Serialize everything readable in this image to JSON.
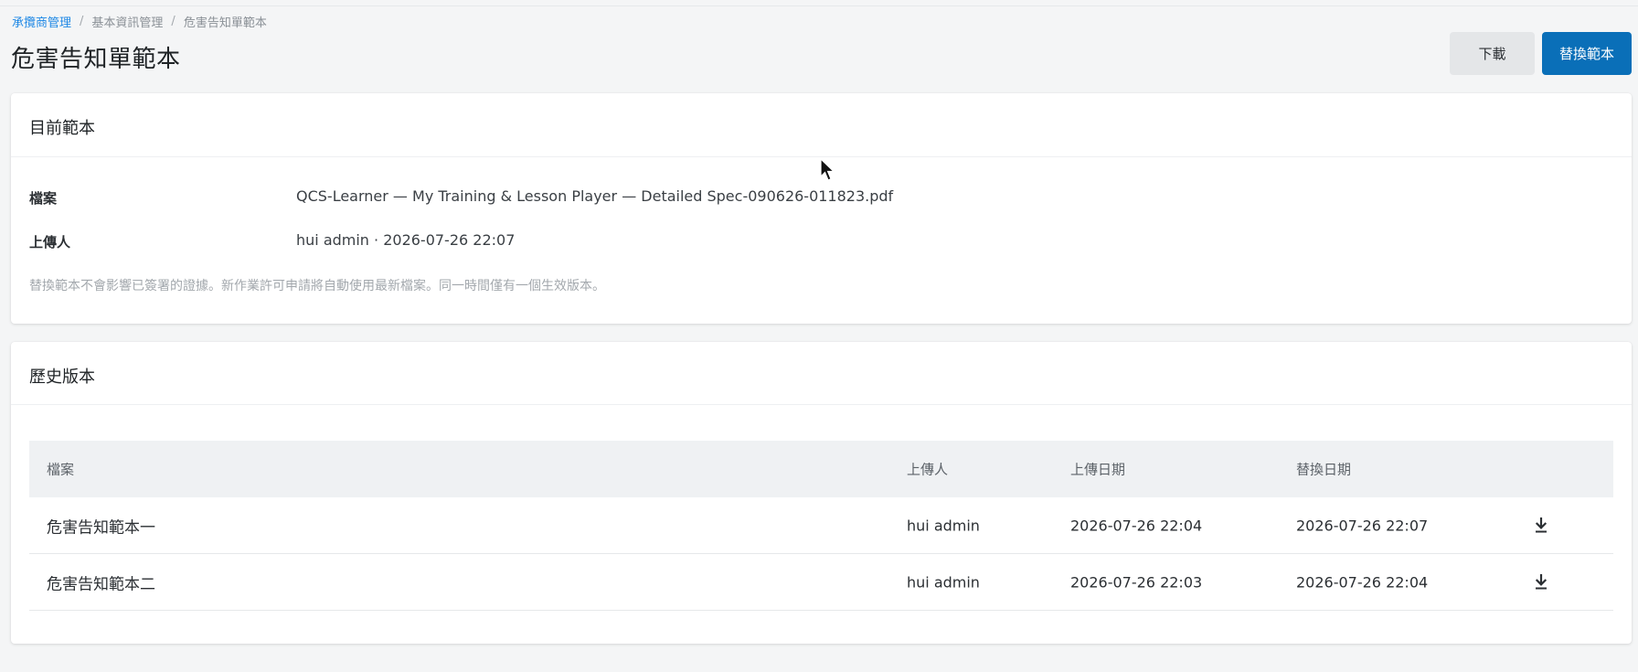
{
  "breadcrumb": {
    "items": [
      "承攬商管理",
      "基本資訊管理",
      "危害告知單範本"
    ],
    "separator": "/"
  },
  "page": {
    "title": "危害告知單範本"
  },
  "toolbar": {
    "download_label": "下載",
    "replace_label": "替換範本"
  },
  "current": {
    "title": "目前範本",
    "file_label": "檔案",
    "file_value": "QCS-Learner — My Training & Lesson Player — Detailed Spec-090626-011823.pdf",
    "uploader_label": "上傳人",
    "uploader_value": "hui admin · 2026-07-26 22:07",
    "note": "替換範本不會影響已簽署的證據。新作業許可申請將自動使用最新檔案。同一時間僅有一個生效版本。"
  },
  "history": {
    "title": "歷史版本",
    "columns": [
      "檔案",
      "上傳人",
      "上傳日期",
      "替換日期"
    ],
    "rows": [
      {
        "file": "危害告知範本一",
        "uploader": "hui admin",
        "upload_date": "2026-07-26 22:04",
        "replace_date": "2026-07-26 22:07"
      },
      {
        "file": "危害告知範本二",
        "uploader": "hui admin",
        "upload_date": "2026-07-26 22:03",
        "replace_date": "2026-07-26 22:04"
      }
    ]
  },
  "colors": {
    "primary": "#0a6fb8",
    "link": "#1e88e5",
    "background": "#f4f5f6"
  },
  "icons": {
    "row_action": "download-icon",
    "pointer": "mouse-cursor-icon"
  }
}
